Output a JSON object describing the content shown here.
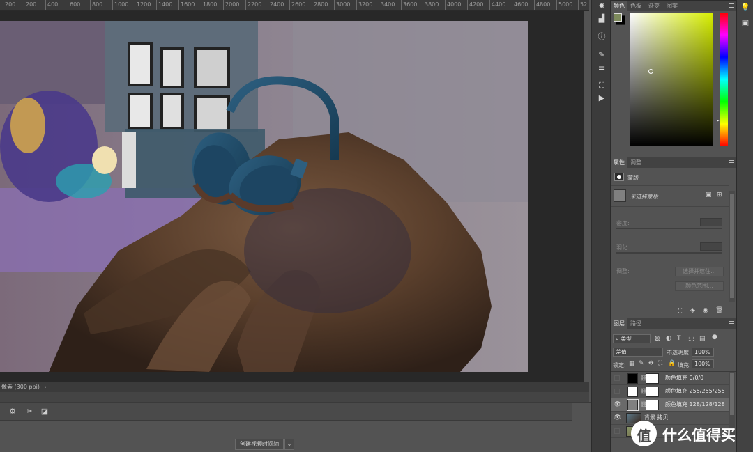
{
  "ruler": {
    "ticks": [
      "200",
      "200",
      "400",
      "600",
      "800",
      "1000",
      "1200",
      "1400",
      "1600",
      "1800",
      "2000",
      "2200",
      "2400",
      "2600",
      "2800",
      "3000",
      "3200",
      "3400",
      "3600",
      "3800",
      "4000",
      "4200",
      "4400",
      "4600",
      "4800",
      "5000",
      "52"
    ]
  },
  "status": {
    "text": "像素 (300 ppi)",
    "arrow": "›"
  },
  "timeline": {
    "create_label": "创建视频时间轴"
  },
  "color_panel": {
    "tabs": [
      "颜色",
      "色板",
      "渐变",
      "图案"
    ],
    "foreground": "#7d8a5c",
    "background": "#000000",
    "hue_color": "#d8f000"
  },
  "properties_panel": {
    "tabs": [
      "属性",
      "调整"
    ],
    "section_title": "蒙版",
    "mask_label": "未选择蒙版",
    "density_label": "密度:",
    "feather_label": "羽化:",
    "adjust_label": "调整:",
    "select_subject_btn": "选择并遮住...",
    "color_range_btn": "颜色范围..."
  },
  "layers_panel": {
    "tabs": [
      "图层",
      "路径"
    ],
    "filter_label": "类型",
    "blend_mode": "差值",
    "opacity_label": "不透明度:",
    "opacity_value": "100%",
    "lock_label": "锁定:",
    "fill_label": "填充:",
    "fill_value": "100%",
    "layers": [
      {
        "name": "颜色填充 0/0/0",
        "visible": false,
        "thumb": "#000000"
      },
      {
        "name": "颜色填充 255/255/255",
        "visible": false,
        "thumb": "#ffffff"
      },
      {
        "name": "颜色填充 128/128/128",
        "visible": true,
        "thumb": "#808080",
        "selected": true
      },
      {
        "name": "背景 拷贝",
        "visible": true,
        "thumb": "photo"
      },
      {
        "name": "背景",
        "visible": false,
        "thumb": "photo"
      }
    ]
  },
  "watermark": {
    "text": "什么值得买",
    "logo": "值"
  }
}
